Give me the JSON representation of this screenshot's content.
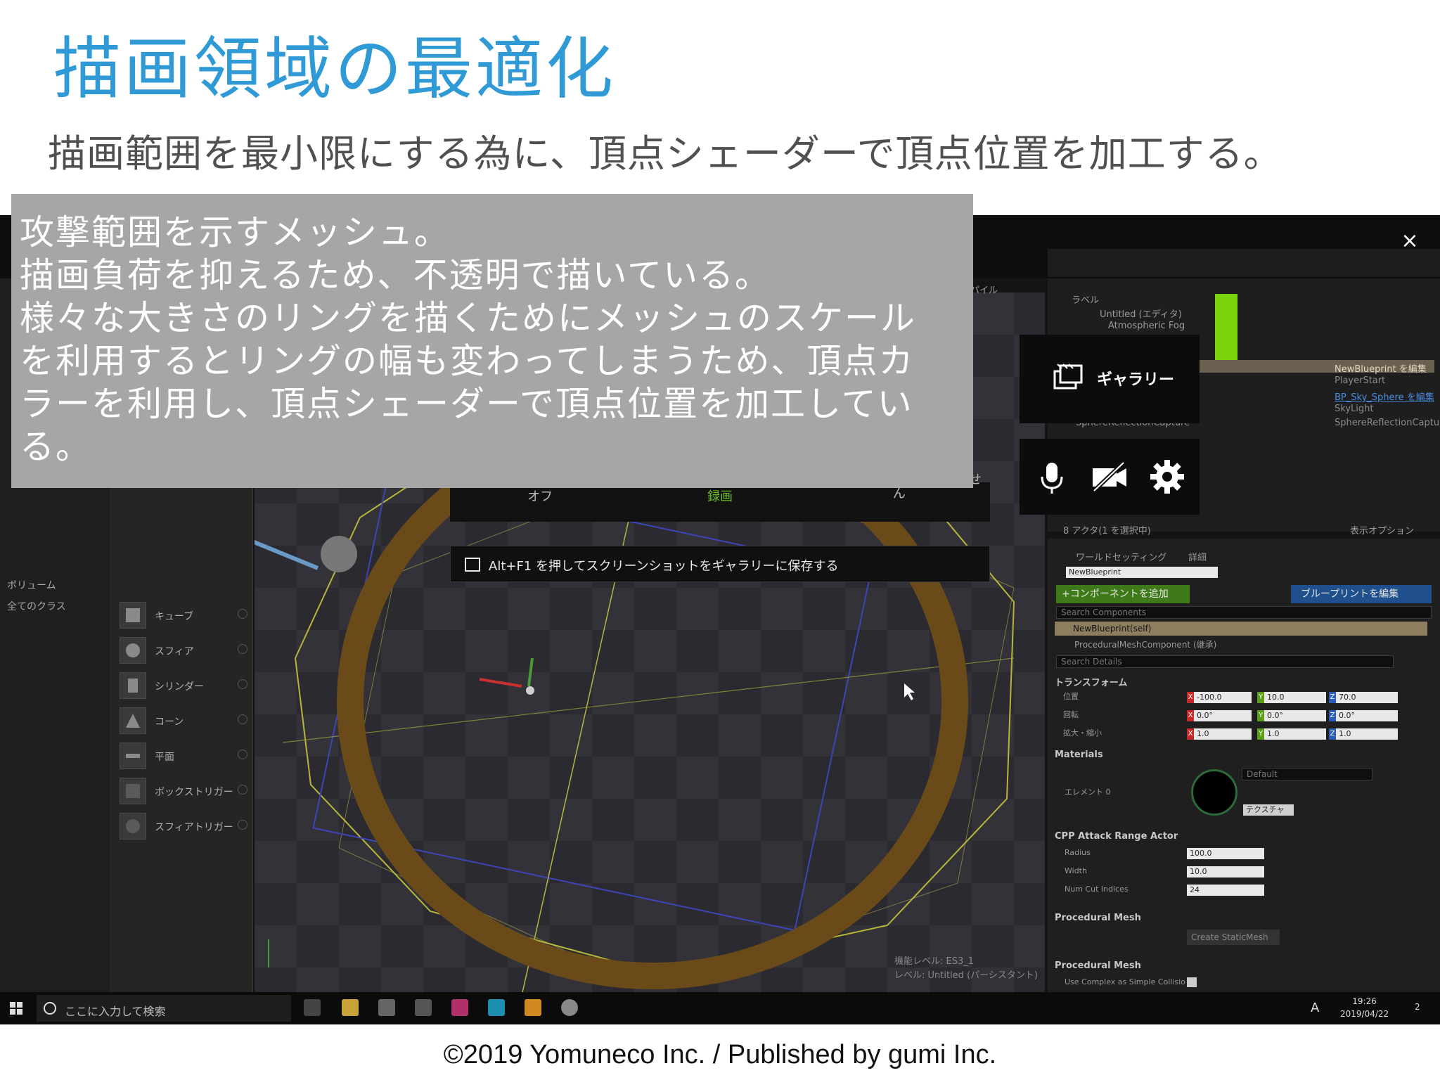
{
  "slide": {
    "title": "描画領域の最適化",
    "subtitle": "描画範囲を最小限にする為に、頂点シェーダーで頂点位置を加工する。",
    "footer": "©2019 Yomuneco Inc. / Published by gumi Inc."
  },
  "annotation": {
    "lines": [
      "攻撃範囲を示すメッシュ。",
      "描画負荷を抑えるため、不透明で描いている。",
      "様々な大きさのリングを描くためにメッシュのスケール",
      "を利用するとリングの幅も変わってしまうため、頂点カ",
      "ラーを利用し、頂点シェーダーで頂点位置を加工してい",
      "る。"
    ]
  },
  "left_panel": {
    "items": [
      "ボリューム",
      "全てのクラス"
    ]
  },
  "shapes": [
    "キューブ",
    "スフィア",
    "シリンダー",
    "コーン",
    "平面",
    "ボックストリガー",
    "スフィアトリガー"
  ],
  "viewport": {
    "feature_level": "機能レベル:  ES3_1",
    "level": "レベル:  Untitled (パーシスタント)"
  },
  "game_bar": {
    "off_label": "オフ",
    "record_label": "録画",
    "n_label": "ん",
    "se_label": "せ",
    "tip": "Alt+F1 を押してスクリーンショットをギャラリーに保存する",
    "gallery": "ギャラリー",
    "close": "×",
    "icons": [
      "gallery-icon",
      "microphone-icon",
      "camera-off-icon",
      "gear-icon"
    ]
  },
  "outliner": {
    "compile": "パイル",
    "label_header": "ラベル",
    "rows": [
      "Untitled (エディタ)",
      "Atmospheric Fog"
    ],
    "edit_blueprint": "NewBlueprint を編集",
    "player_start": "PlayerStart",
    "sky_sphere_link": "BP_Sky_Sphere を編集",
    "sky_light": "SkyLight",
    "sphere_reflection": "SphereReflectionCapture",
    "partial_row": "SphereReflectionCapture",
    "status": "8 アクタ(1 を選択中)",
    "view_options": "表示オプション"
  },
  "details": {
    "tab_world": "ワールドセッティング",
    "tab_details": "詳細",
    "actor_name": "NewBlueprint",
    "add_component": "+コンポーネントを追加",
    "edit_blueprint": "ブループリントを編集",
    "search_components": "Search Components",
    "self_row": "NewBlueprint(self)",
    "proc_mesh_row": "ProceduralMeshComponent (継承)",
    "search_details": "Search Details",
    "transform_header": "トランスフォーム",
    "location_label": "位置",
    "rotation_label": "回転",
    "scale_label": "拡大・縮小",
    "location": [
      "-100.0",
      "10.0",
      "70.0"
    ],
    "rotation": [
      "0.0°",
      "0.0°",
      "0.0°"
    ],
    "scale": [
      "1.0",
      "1.0",
      "1.0"
    ],
    "materials_header": "Materials",
    "element_label": "エレメント 0",
    "material_default": "Default",
    "texture_button": "テクスチャ",
    "cpp_header": "CPP Attack Range Actor",
    "radius_label": "Radius",
    "radius": "100.0",
    "width_label": "Width",
    "width": "10.0",
    "num_cut_label": "Num Cut Indices",
    "num_cut": "24",
    "proc_mesh_header1": "Procedural Mesh",
    "create_static_mesh": "Create StaticMesh",
    "proc_mesh_header2": "Procedural Mesh",
    "use_complex": "Use Complex as Simple Collisio"
  },
  "taskbar": {
    "search_placeholder": "ここに入力して検索",
    "time": "19:26",
    "date": "2019/04/22",
    "ime": "A",
    "notifications": "2"
  },
  "colors": {
    "title_blue": "#2f9ad6",
    "annotation_bg": "#a6a6a6",
    "ring_orange": "#6b4a1a",
    "green_accent": "#7ad40a"
  }
}
